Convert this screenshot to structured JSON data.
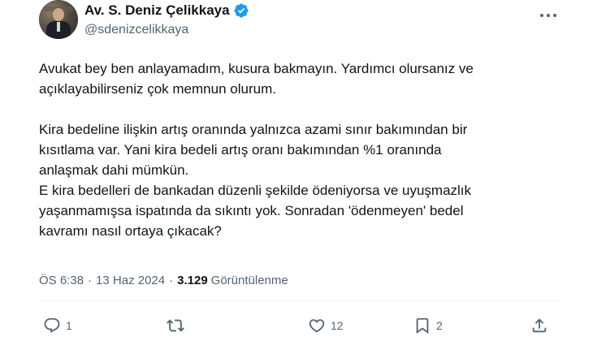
{
  "author": {
    "display_name": "Av. S. Deniz Çelikkaya",
    "handle": "@sdenizcelikkaya",
    "verified": true,
    "verified_color": "#1d9bf0"
  },
  "tweet": {
    "text": "Avukat bey ben anlayamadım, kusura bakmayın. Yardımcı olursanız ve\naçıklayabilirseniz çok memnun olurum.\n\nKira bedeline ilişkin artış oranında yalnızca azami sınır bakımından bir\nkısıtlama var. Yani kira bedeli artış oranı bakımından %1 oranında\nanlaşmak dahi mümkün.\nE kira bedelleri de bankadan düzenli şekilde ödeniyorsa ve uyuşmazlık\nyaşanmamışsa ispatında da sıkıntı yok. Sonradan 'ödenmeyen' bedel\nkavramı nasıl ortaya çıkacak?",
    "time": "ÖS 6:38",
    "separator": "·",
    "date": "13 Haz 2024",
    "views_count": "3.129",
    "views_label": "Görüntülenme"
  },
  "actions": {
    "reply_icon": "reply-icon",
    "reply_count": "1",
    "retweet_icon": "retweet-icon",
    "retweet_count": "",
    "like_icon": "heart-icon",
    "like_count": "12",
    "bookmark_icon": "bookmark-icon",
    "bookmark_count": "2",
    "share_icon": "share-icon"
  },
  "colors": {
    "text_primary": "#0f1419",
    "text_secondary": "#536471",
    "divider": "#eff3f4"
  }
}
